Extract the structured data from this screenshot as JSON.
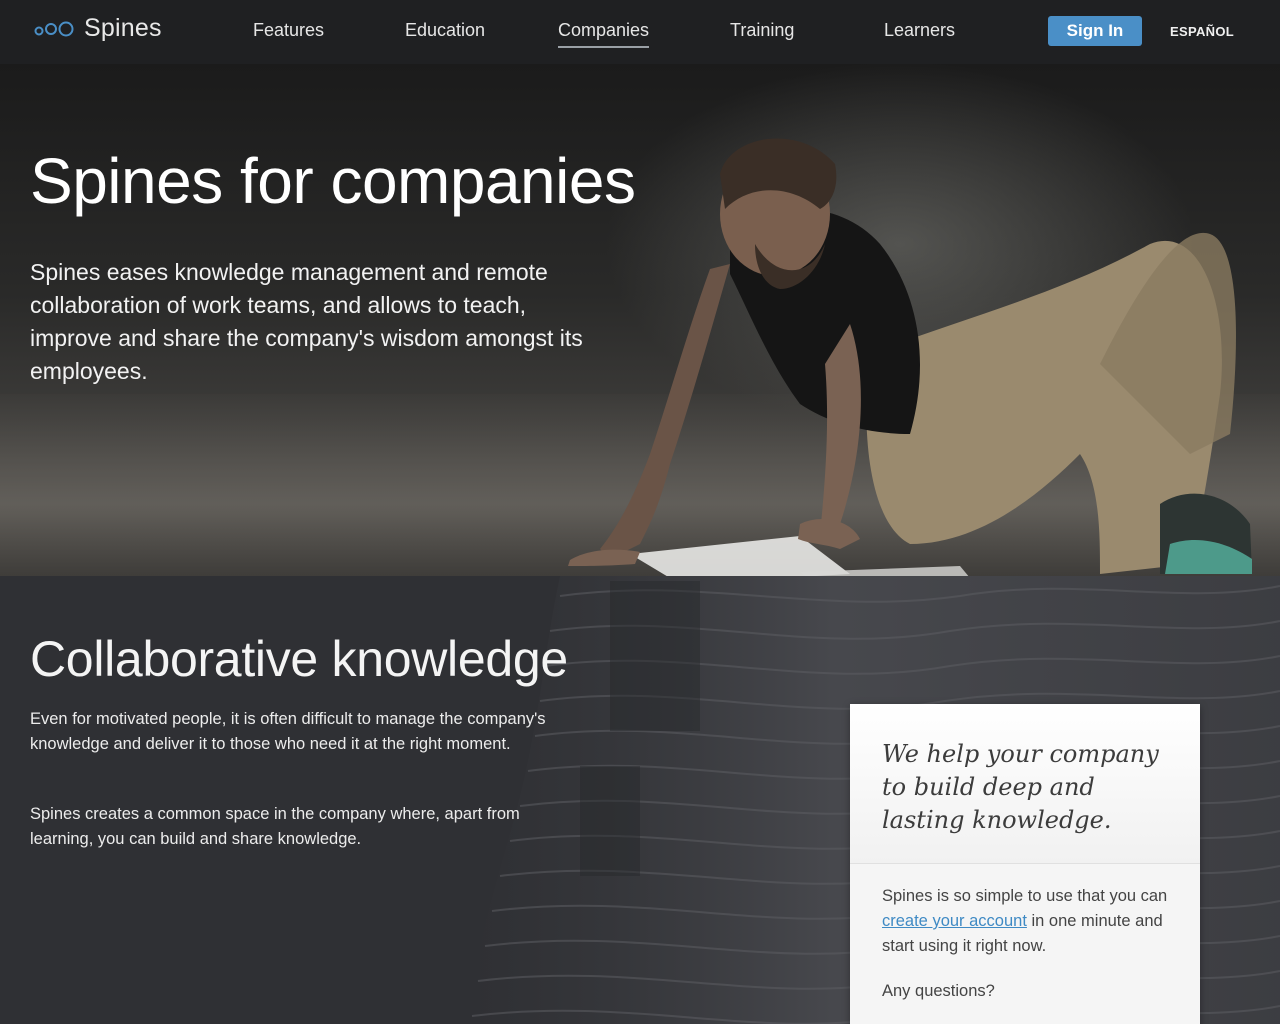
{
  "nav": {
    "brand": "Spines",
    "items": [
      {
        "label": "Features"
      },
      {
        "label": "Education"
      },
      {
        "label": "Companies",
        "active": true
      },
      {
        "label": "Training"
      },
      {
        "label": "Learners"
      }
    ],
    "signin_label": "Sign In",
    "language_label": "ESPAÑOL",
    "accent_color": "#4a8fc7"
  },
  "hero": {
    "title": "Spines for companies",
    "subtitle": "Spines eases knowledge management and remote collaboration of work teams, and allows to teach, improve and share the company's wisdom amongst its employees."
  },
  "section": {
    "title": "Collaborative knowledge",
    "paragraph1": "Even for motivated people, it is often difficult to manage the company's knowledge and deliver it to those who need it at the right moment.",
    "paragraph2": "Spines creates a common space in the company where, apart from learning, you can build and share knowledge."
  },
  "card": {
    "heading": "We help your company to build deep and lasting knowledge.",
    "text_before_link": "Spines is so simple to use that you can ",
    "link_label": "create your account",
    "text_after_link": " in one minute and start using it right now.",
    "question": "Any questions?"
  }
}
